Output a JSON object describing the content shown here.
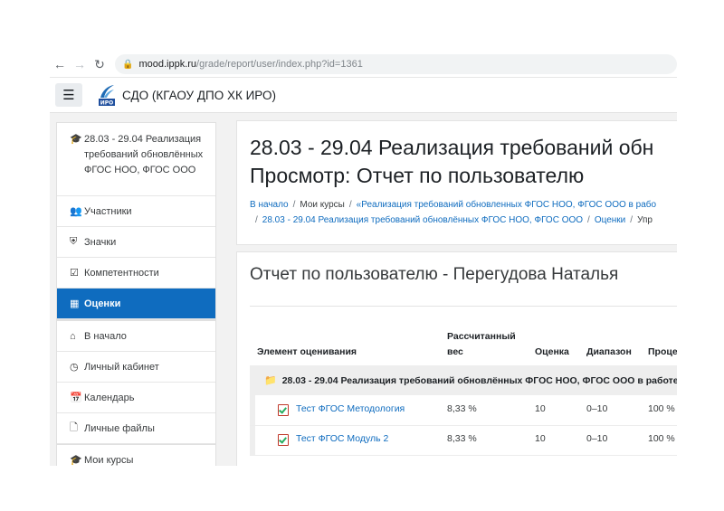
{
  "browser": {
    "back_icon": "arrow-left-icon",
    "forward_icon": "arrow-right-icon",
    "reload_icon": "reload-icon",
    "url_host": "mood.ippk.ru",
    "url_path": "/grade/report/user/index.php?id=1361"
  },
  "navbar": {
    "menu_icon": "hamburger-icon",
    "logo_text": "ИРО",
    "site_name": "СДО (КГАОУ ДПО ХК ИРО)"
  },
  "drawer": {
    "course_item": "28.03 - 29.04 Реализация требований обновлённых ФГОС НОО, ФГОС ООО",
    "items": [
      {
        "label": "Участники",
        "icon": "users-icon"
      },
      {
        "label": "Значки",
        "icon": "shield-icon"
      },
      {
        "label": "Компетентности",
        "icon": "checkbox-icon"
      },
      {
        "label": "Оценки",
        "icon": "table-icon",
        "active": true
      }
    ],
    "items2": [
      {
        "label": "В начало",
        "icon": "home-icon"
      },
      {
        "label": "Личный кабинет",
        "icon": "dashboard-icon"
      },
      {
        "label": "Календарь",
        "icon": "calendar-icon"
      },
      {
        "label": "Личные файлы",
        "icon": "file-icon"
      }
    ],
    "items3": [
      {
        "label": "Мои курсы",
        "icon": "graduation-cap-icon"
      }
    ]
  },
  "header": {
    "title_line1": "28.03 - 29.04 Реализация требований обн",
    "title_line2": "Просмотр: Отчет по пользователю",
    "breadcrumb": {
      "home": "В начало",
      "my_courses": "Мои курсы",
      "category": "«Реализация требований обновленных ФГОС НОО, ФГОС ООО в рабо",
      "course": "28.03 - 29.04 Реализация требований обновлённых ФГОС НОО, ФГОС ООО",
      "grades": "Оценки",
      "current": "Упр"
    }
  },
  "report": {
    "heading": "Отчет по пользователю - Перегудова Наталья",
    "columns": {
      "item": "Элемент оценивания",
      "weight_line1": "Рассчитанный",
      "weight_line2": "вес",
      "grade": "Оценка",
      "range": "Диапазон",
      "percent": "Проце"
    },
    "category": "28.03 - 29.04 Реализация требований обновлённых ФГОС НОО, ФГОС ООО в работе",
    "rows": [
      {
        "name": "Тест ФГОС Методология",
        "weight": "8,33 %",
        "grade": "10",
        "range": "0–10",
        "percent": "100 %"
      },
      {
        "name": "Тест ФГОС Модуль 2",
        "weight": "8,33 %",
        "grade": "10",
        "range": "0–10",
        "percent": "100 %"
      }
    ]
  }
}
